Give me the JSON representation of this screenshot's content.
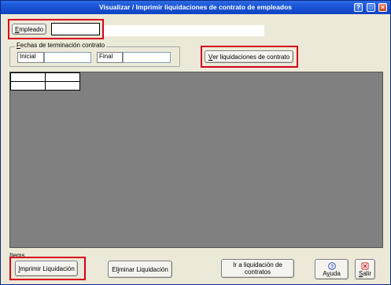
{
  "window": {
    "title": "Visualizar / Imprimir liquidaciones de contrato de empleados"
  },
  "employee": {
    "button_label": "Empleado",
    "button_underline": "E",
    "button_rest": "mpleado",
    "value": ""
  },
  "dates_group": {
    "label_prefix": "F",
    "label_rest": "echas de terminación contrato",
    "start_label": "Inicial",
    "start_value": "",
    "end_label": "Final",
    "end_value": ""
  },
  "view_button": {
    "underline": "V",
    "rest": "er liquidaciones de contrato"
  },
  "items_label": "Items",
  "buttons": {
    "print_underline": "I",
    "print_rest": "mprimir Liquidación",
    "delete_pre": "El",
    "delete_underline": "i",
    "delete_rest": "minar Liquidación",
    "goto_line1": "Ir a liquidación de",
    "goto_line2": "contratos",
    "help_pre": "A",
    "help_underline": "y",
    "help_rest": "uda",
    "exit_underline": "S",
    "exit_rest": "alir"
  },
  "colors": {
    "titlebar": "#1a56d6",
    "highlight": "#d6001c",
    "grid_bg": "#808080"
  }
}
